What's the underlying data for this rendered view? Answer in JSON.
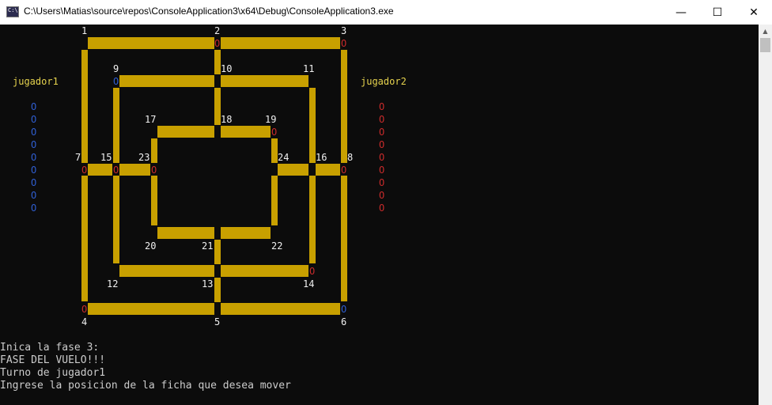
{
  "window": {
    "title": "C:\\Users\\Matias\\source\\repos\\ConsoleApplication3\\x64\\Debug\\ConsoleApplication3.exe",
    "minimize_glyph": "—",
    "maximize_glyph": "☐",
    "close_glyph": "✕"
  },
  "colors": {
    "board": "#c8a000",
    "blue_piece": "#2f5ed1",
    "red_piece": "#c82b2b",
    "text": "#cccccc",
    "player_label": "#e6d34e"
  },
  "board": {
    "position_labels": [
      "1",
      "2",
      "3",
      "4",
      "5",
      "6",
      "7",
      "8",
      "9",
      "10",
      "11",
      "12",
      "13",
      "14",
      "15",
      "16",
      "17",
      "18",
      "19",
      "20",
      "21",
      "22",
      "23",
      "24"
    ],
    "piece_glyph": "O",
    "placed_pieces": [
      {
        "pos": "2",
        "color": "red"
      },
      {
        "pos": "3",
        "color": "red"
      },
      {
        "pos": "9",
        "color": "blue"
      },
      {
        "pos": "19",
        "color": "red"
      },
      {
        "pos": "7",
        "color": "red"
      },
      {
        "pos": "15",
        "color": "red"
      },
      {
        "pos": "23",
        "color": "red"
      },
      {
        "pos": "8",
        "color": "red"
      },
      {
        "pos": "14",
        "color": "red"
      },
      {
        "pos": "4",
        "color": "red"
      },
      {
        "pos": "6",
        "color": "blue"
      }
    ]
  },
  "player1": {
    "label": "jugador1",
    "reserve_count": 9,
    "color": "blue"
  },
  "player2": {
    "label": "jugador2",
    "reserve_count": 9,
    "color": "red"
  },
  "messages": [
    "Inica la fase 3:",
    "FASE DEL VUELO!!!",
    "Turno de jugador1",
    "Ingrese la posicion de la ficha que desea mover"
  ]
}
